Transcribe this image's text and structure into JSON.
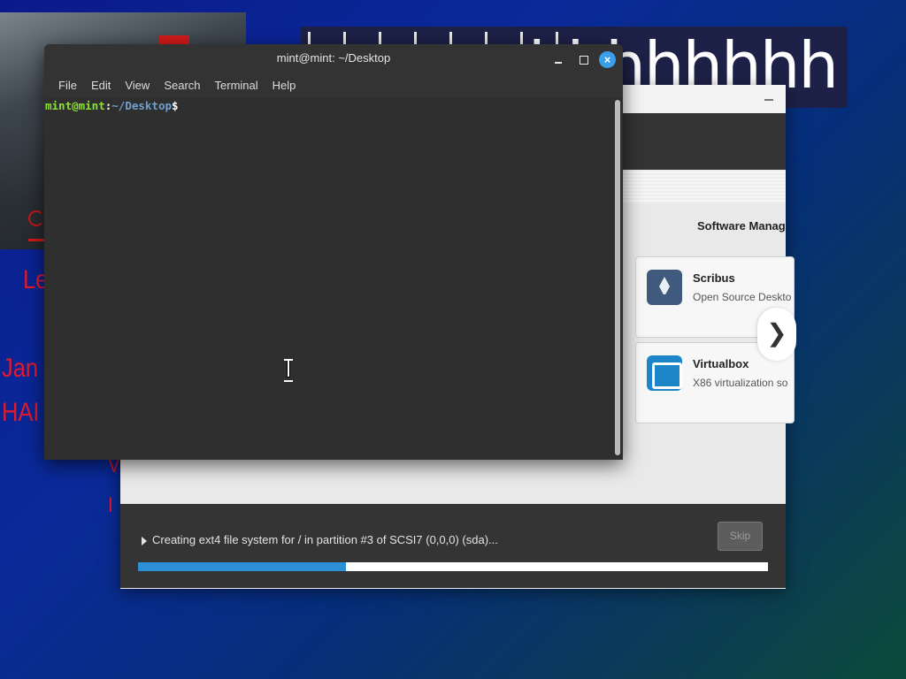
{
  "terminal": {
    "title": "mint@mint: ~/Desktop",
    "menu": [
      "File",
      "Edit",
      "View",
      "Search",
      "Terminal",
      "Help"
    ],
    "prompt_user": "mint@mint",
    "prompt_sep": ":",
    "prompt_path": "~/Desktop",
    "prompt_symbol": "$"
  },
  "installer": {
    "slide_title": "Software Manag",
    "apps": [
      {
        "name": "Scribus",
        "description": "Open Source Deskto",
        "icon": "scribus-icon"
      },
      {
        "name": "Virtualbox",
        "description": "X86 virtualization so",
        "icon": "virtualbox-icon"
      }
    ],
    "next_glyph": "❯",
    "status_text": "Creating ext4 file system for / in partition #3 of SCSI7 (0,0,0) (sda)...",
    "skip_label": "Skip",
    "progress_percent": 33
  },
  "wallpaper": {
    "banner_text": "hhhhhhhh",
    "red_texts": [
      "Le",
      "Jan",
      "HAI",
      "V",
      "I"
    ]
  },
  "colors": {
    "terminal_bg": "#2f2f2f",
    "prompt_user": "#8ae234",
    "prompt_path": "#729fcf",
    "progress": "#2d8fd5",
    "close_button": "#3a9ee8"
  }
}
